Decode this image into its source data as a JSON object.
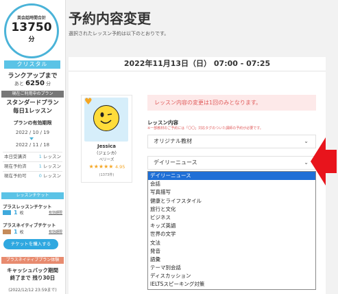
{
  "sidebar": {
    "total_label": "英会話時間合計",
    "total_value": "13750",
    "total_unit": "分",
    "rank": "クリスタル",
    "rankup_label": "ランクアップまで",
    "rankup_prefix": "あと",
    "rankup_value": "6250",
    "rankup_unit": "分",
    "plan_header": "現在ご利用中のプラン",
    "plan_name_1": "スタンダードプラン",
    "plan_name_2": "毎日1レッスン",
    "valid_label": "プランの有効期限",
    "valid_from": "2022 / 10 / 19",
    "valid_to": "2022 / 11 / 18",
    "stats": [
      {
        "label": "本日受講済",
        "value": "1",
        "unit": "レッスン"
      },
      {
        "label": "現在予約済",
        "value": "1",
        "unit": "レッスン"
      },
      {
        "label": "現在予約可",
        "value": "0",
        "unit": "レッスン"
      }
    ],
    "ticket_header": "レッスンチケット",
    "ticket_1_name": "プラスレッスンチケット",
    "ticket_1_count": "1",
    "ticket_1_unit": "枚",
    "ticket_1_expiry": "有効期限",
    "ticket_2_name": "プラスネイティブチケット",
    "ticket_2_count": "1",
    "ticket_2_unit": "枚",
    "ticket_2_expiry": "有効期限",
    "buy_button": "チケットを購入する",
    "promo_header": "プラスネイティブプラン体験",
    "cashback_1": "キャッシュバック期間",
    "cashback_2": "終了まで 残り30日",
    "cashback_date": "(2022/12/12 23:59まで)"
  },
  "main": {
    "title": "予約内容変更",
    "subtitle": "選択されたレッスン予約は以下のとおりです。",
    "date": "2022年11月13日（日） 07:00 - 07:25",
    "alert": "レッスン内容の変更は1回のみとなります。",
    "lesson_label": "レッスン内容",
    "lesson_note": "※一部教材のご予約には「〇〇」対応タグのついた講師の予約が必要です。",
    "select_material": "オリジナル教材",
    "select_topic": "デイリーニュース",
    "options": [
      "デイリーニュース",
      "会話",
      "写真描写",
      "健康とライフスタイル",
      "旅行と文化",
      "ビジネス",
      "キッズ英語",
      "世界の文学",
      "文法",
      "発音",
      "語彙",
      "テーマ別会話",
      "ディスカッション",
      "IELTSスピーキング対策"
    ]
  },
  "tutor": {
    "name": "Jessica",
    "kana": "（ジェシカ）",
    "nationality": "ベリーズ",
    "stars": "★★★★★",
    "rating": "4.95",
    "reviews": "(1373件)"
  },
  "colors": {
    "accent": "#4ab3d8",
    "alert_text": "#e05b5b",
    "selected_option": "#1f6fd6",
    "arrow": "#e8141c"
  },
  "icons": {
    "favorite": "heart-icon",
    "chevron": "chevron-down-icon",
    "arrow": "left-arrow-icon"
  }
}
